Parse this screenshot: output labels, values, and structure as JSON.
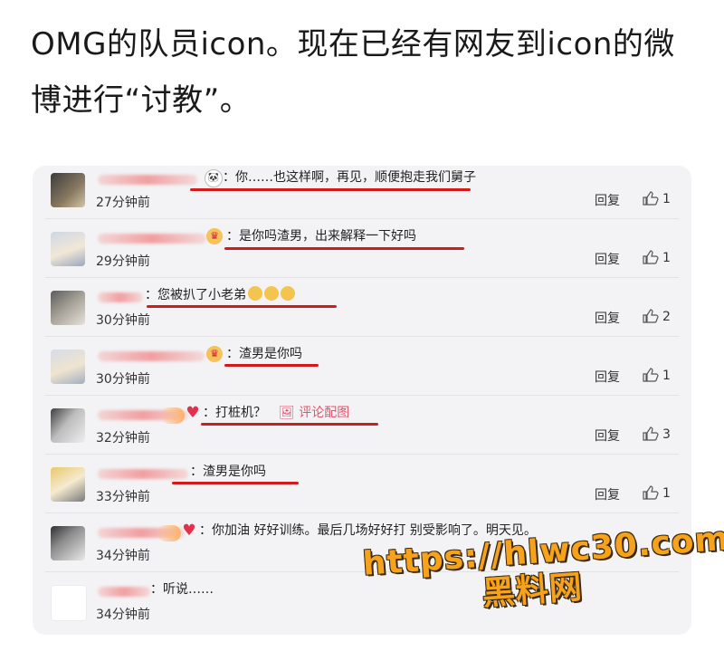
{
  "headline": "OMG的队员icon。现在已经有网友到icon的微博进行“讨教”。",
  "comments": [
    {
      "text": "：你……也这样啊，再见，顺便抱走我们舅子",
      "time": "27分钟前",
      "reply": "回复",
      "likes": "1",
      "badge": "panda-icon"
    },
    {
      "text": "：是你吗渣男，出来解释一下好吗",
      "time": "29分钟前",
      "reply": "回复",
      "likes": "1",
      "badge": "crown-icon"
    },
    {
      "text": "：您被扒了小老弟",
      "time": "30分钟前",
      "reply": "回复",
      "likes": "2",
      "badge": ""
    },
    {
      "text": "：渣男是你吗",
      "time": "30分钟前",
      "reply": "回复",
      "likes": "1",
      "badge": "crown-icon"
    },
    {
      "text": "：打桩机？",
      "image_link": "评论配图",
      "time": "32分钟前",
      "reply": "回复",
      "likes": "3",
      "badge": "heart-icon"
    },
    {
      "text": "：渣男是你吗",
      "time": "33分钟前",
      "reply": "回复",
      "likes": "1",
      "badge": ""
    },
    {
      "text": "：你加油 好好训练。最后几场好好打 别受影响了。明天见。",
      "time": "34分钟前",
      "reply": "回复",
      "likes": "",
      "badge": "heart-icon"
    },
    {
      "text": "：听说……",
      "time": "34分钟前",
      "reply": "",
      "likes": "",
      "badge": ""
    }
  ],
  "watermark": {
    "line1": "https://hlwc30.com",
    "line2": "黑料网"
  },
  "colors": {
    "underline": "#d21a1a",
    "panel": "#f3f3f5",
    "watermark": "#f7a21b"
  }
}
